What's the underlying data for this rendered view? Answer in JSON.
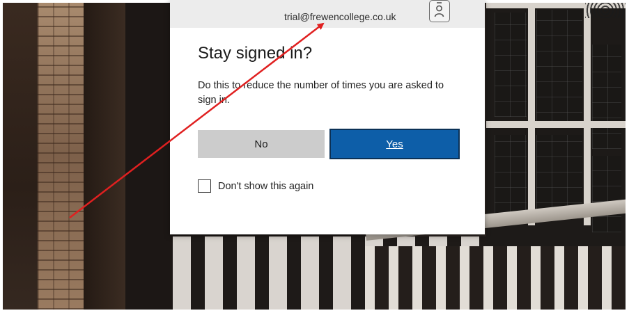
{
  "dialog": {
    "account_email": "trial@frewencollege.co.uk",
    "account_icon": "badge-person-icon",
    "title": "Stay signed in?",
    "description": "Do this to reduce the number of times you are asked to sign in.",
    "no_label": "No",
    "yes_label": "Yes",
    "dont_show_label": "Don't show this again",
    "dont_show_checked": false
  },
  "annotation": {
    "arrow_color": "#e02020",
    "arrow_points_to": "account_email"
  },
  "colors": {
    "yes_button": "#0d5ea8",
    "no_button": "#cccccc",
    "account_bar": "#ececec"
  }
}
